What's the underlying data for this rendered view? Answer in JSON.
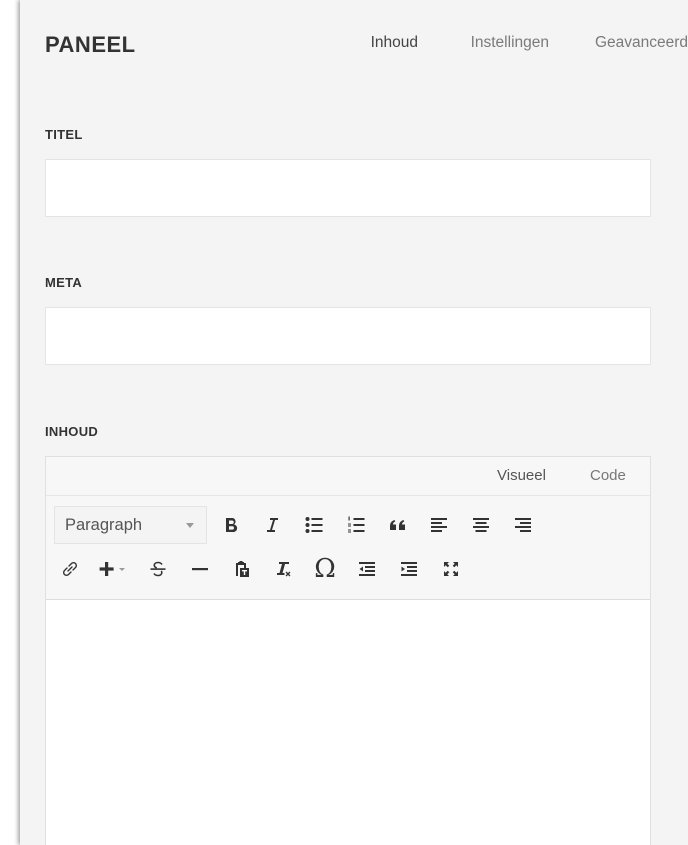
{
  "panel": {
    "title": "PANEEL",
    "tabs": [
      {
        "label": "Inhoud",
        "active": true
      },
      {
        "label": "Instellingen",
        "active": false
      },
      {
        "label": "Geavanceerd",
        "active": false
      }
    ]
  },
  "fields": {
    "title_label": "TITEL",
    "title_value": "",
    "meta_label": "META",
    "meta_value": "",
    "content_label": "INHOUD"
  },
  "editor": {
    "modes": {
      "visual": "Visueel",
      "code": "Code"
    },
    "format_select": "Paragraph",
    "toolbar_row1": [
      "bold-icon",
      "italic-icon",
      "bullet-list-icon",
      "numbered-list-icon",
      "blockquote-icon",
      "align-left-icon",
      "align-center-icon",
      "align-right-icon"
    ],
    "toolbar_row2": [
      "link-icon",
      "insert-plus-icon",
      "strikethrough-icon",
      "horizontal-rule-icon",
      "paste-as-text-icon",
      "clear-formatting-icon",
      "special-character-icon",
      "outdent-icon",
      "indent-icon",
      "fullscreen-icon"
    ],
    "content": ""
  },
  "colors": {
    "panel_bg": "#f4f4f4",
    "input_bg": "#ffffff",
    "toolbar_bg": "#f7f7f7"
  }
}
